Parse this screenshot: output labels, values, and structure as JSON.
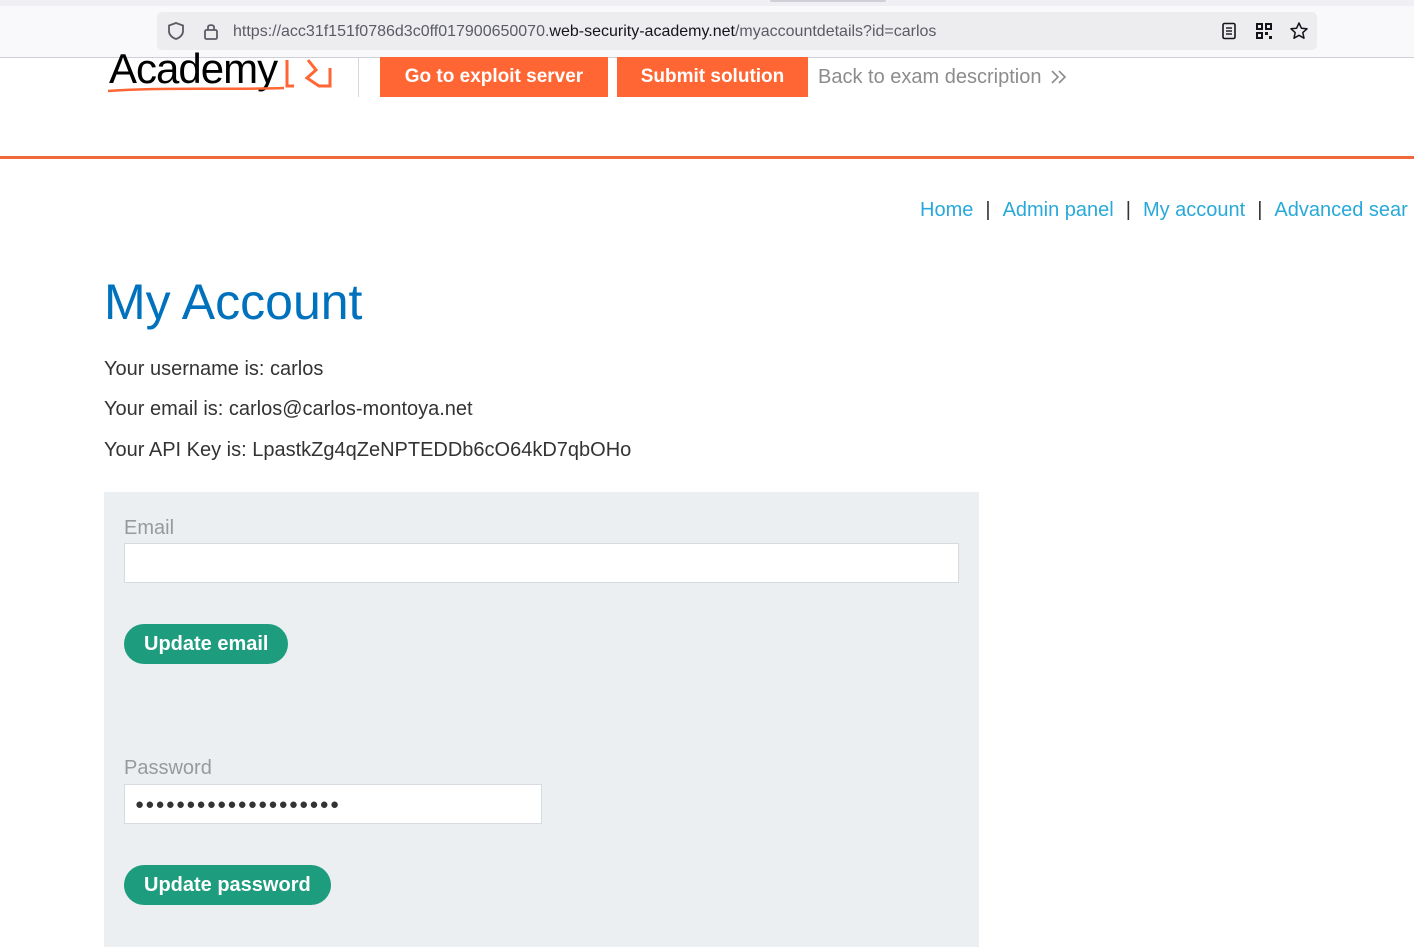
{
  "browser": {
    "url_prefix": "https://acc31f151f0786d3c0ff017900650070.",
    "url_host": "web-security-academy.net",
    "url_path": "/myaccountdetails?id=carlos",
    "icons": [
      "shield-icon",
      "lock-icon",
      "reader-view-icon",
      "qr-code-icon",
      "bookmark-star-icon"
    ]
  },
  "header": {
    "logo_text": "Academy",
    "exploit_button": "Go to exploit server",
    "submit_button": "Submit solution",
    "back_link": "Back to exam description",
    "accent_color": "#ff6633"
  },
  "nav": {
    "items": [
      "Home",
      "Admin panel",
      "My account",
      "Advanced sear"
    ],
    "separator": "|",
    "link_color": "#29a9d9"
  },
  "main": {
    "title": "My Account",
    "username_line": "Your username is: carlos",
    "email_line": "Your email is: carlos@carlos-montoya.net",
    "apikey_line": "Your API Key is: LpastkZg4qZeNPTEDDb6cO64kD7qbOHo"
  },
  "form": {
    "email_label": "Email",
    "email_value": "",
    "update_email_button": "Update email",
    "password_label": "Password",
    "password_mask": "●●●●●●●●●●●●●●●●●●●●",
    "update_password_button": "Update password",
    "button_color": "#1d9c7e",
    "panel_color": "#ebeff2"
  }
}
